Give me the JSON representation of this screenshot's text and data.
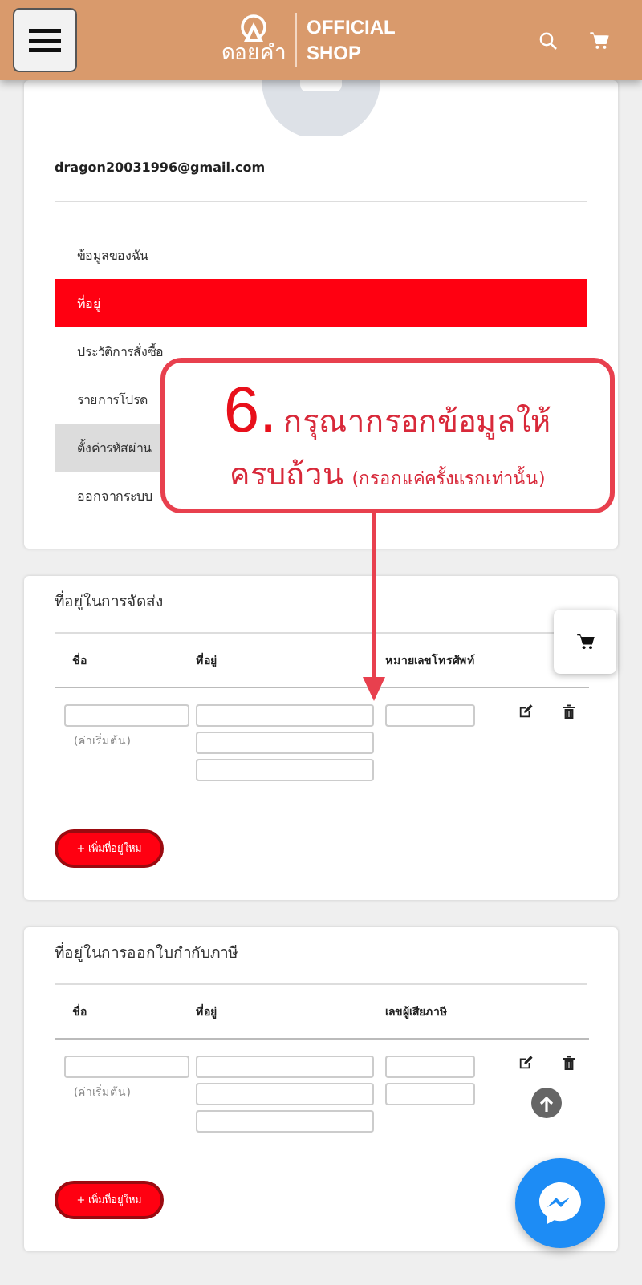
{
  "header": {
    "brand": "ดอยคำ",
    "tagline_1": "OFFICIAL",
    "tagline_2": "SHOP"
  },
  "profile": {
    "email": "dragon20031996@gmail.com"
  },
  "menu": [
    {
      "label": "ข้อมูลของฉัน",
      "selected": false,
      "hovered": false
    },
    {
      "label": "ที่อยู่",
      "selected": true,
      "hovered": false
    },
    {
      "label": "ประวัติการสั่งซื้อ",
      "selected": false,
      "hovered": false
    },
    {
      "label": "รายการโปรด",
      "selected": false,
      "hovered": false
    },
    {
      "label": "ตั้งค่ารหัสผ่าน",
      "selected": false,
      "hovered": true
    },
    {
      "label": "ออกจากระบบ",
      "selected": false,
      "hovered": false
    }
  ],
  "callout": {
    "number": "6.",
    "line_1": "กรุณากรอกข้อมูลให้",
    "line_2": "ครบถ้วน",
    "note": "(กรอกแค่ครั้งแรกเท่านั้น)"
  },
  "sections": [
    {
      "title": "ที่อยู่ในการจัดส่ง",
      "columns": [
        "ชื่อ",
        "ที่อยู่",
        "หมายเลขโทรศัพท์"
      ],
      "rows": [
        {
          "cells": [
            {
              "inputs": [
                {
                  "kind": "text"
                }
              ],
              "note": "(ค่าเริ่มต้น)"
            },
            {
              "inputs": [
                {
                  "kind": "text"
                },
                {
                  "kind": "text"
                },
                {
                  "kind": "text"
                }
              ]
            },
            {
              "inputs": [
                {
                  "kind": "text"
                }
              ]
            }
          ]
        }
      ],
      "add_button": "+ เพิ่มที่อยู่ใหม่"
    },
    {
      "title": "ที่อยู่ในการออกใบกำกับภาษี",
      "columns": [
        "ชื่อ",
        "ที่อยู่",
        "เลขผู้เสียภาษี"
      ],
      "rows": [
        {
          "cells": [
            {
              "inputs": [
                {
                  "kind": "text"
                }
              ],
              "note": "(ค่าเริ่มต้น)"
            },
            {
              "inputs": [
                {
                  "kind": "text"
                },
                {
                  "kind": "text"
                },
                {
                  "kind": "text"
                }
              ]
            },
            {
              "inputs": [
                {
                  "kind": "text"
                },
                {
                  "kind": "text"
                }
              ]
            }
          ]
        }
      ],
      "add_button": "+ เพิ่มที่อยู่ใหม่"
    }
  ]
}
